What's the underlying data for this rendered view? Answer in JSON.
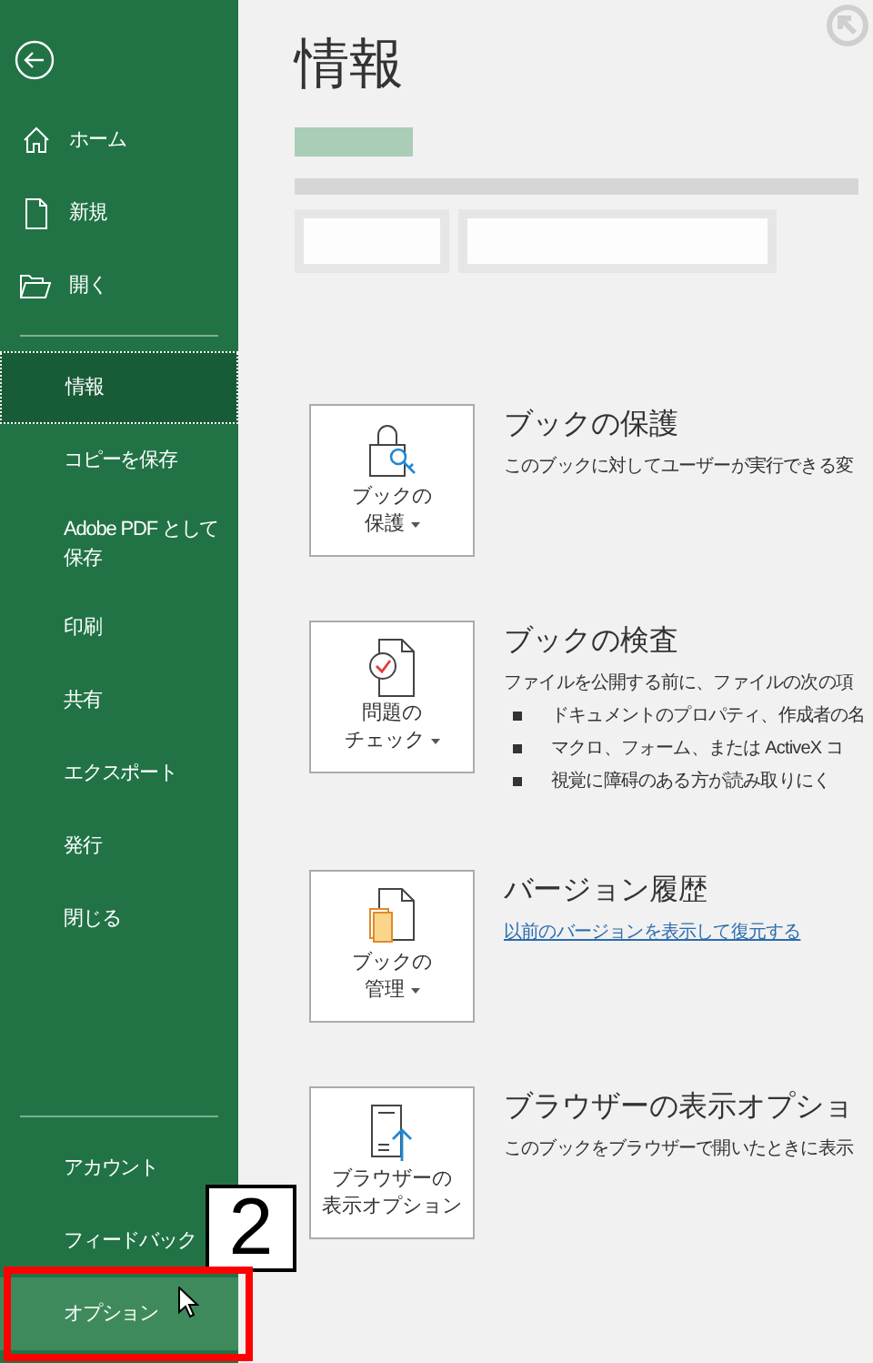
{
  "sidebar": {
    "top_items": [
      {
        "label": "ホーム",
        "kind": "home"
      },
      {
        "label": "新規",
        "kind": "new"
      },
      {
        "label": "開く",
        "kind": "open"
      }
    ],
    "items": [
      {
        "label": "情報",
        "selected": true
      },
      {
        "label": "コピーを保存",
        "selected": false
      },
      {
        "label": "Adobe PDF として保存",
        "selected": false
      },
      {
        "label": "印刷",
        "selected": false
      },
      {
        "label": "共有",
        "selected": false
      },
      {
        "label": "エクスポート",
        "selected": false
      },
      {
        "label": "発行",
        "selected": false
      },
      {
        "label": "閉じる",
        "selected": false
      }
    ],
    "bottom_items": [
      {
        "label": "アカウント",
        "hovered": false
      },
      {
        "label": "フィードバック",
        "hovered": false
      },
      {
        "label": "オプション",
        "hovered": true
      }
    ]
  },
  "main": {
    "title": "情報",
    "cards": [
      {
        "kind": "lock",
        "button_lines": [
          "ブックの",
          "保護"
        ],
        "dropdown": true,
        "heading": "ブックの保護",
        "body": {
          "kind": "text",
          "text": "このブックに対してユーザーが実行できる変"
        }
      },
      {
        "kind": "inspect",
        "button_lines": [
          "問題の",
          "チェック"
        ],
        "dropdown": true,
        "heading": "ブックの検査",
        "body": {
          "kind": "bullets",
          "text": "ファイルを公開する前に、ファイルの次の項",
          "bullets": [
            "ドキュメントのプロパティ、作成者の名",
            "マクロ、フォーム、または ActiveX コ",
            "視覚に障碍のある方が読み取りにく"
          ]
        }
      },
      {
        "kind": "manage",
        "button_lines": [
          "ブックの",
          "管理"
        ],
        "dropdown": true,
        "heading": "バージョン履歴",
        "body": {
          "kind": "link",
          "text": "以前のバージョンを表示して復元する"
        }
      },
      {
        "kind": "browser",
        "button_lines": [
          "ブラウザーの",
          "表示オプション"
        ],
        "dropdown": false,
        "heading": "ブラウザーの表示オプショ",
        "body": {
          "kind": "text",
          "text": "このブックをブラウザーで開いたときに表示"
        }
      }
    ]
  },
  "annotation": {
    "label": "2"
  }
}
